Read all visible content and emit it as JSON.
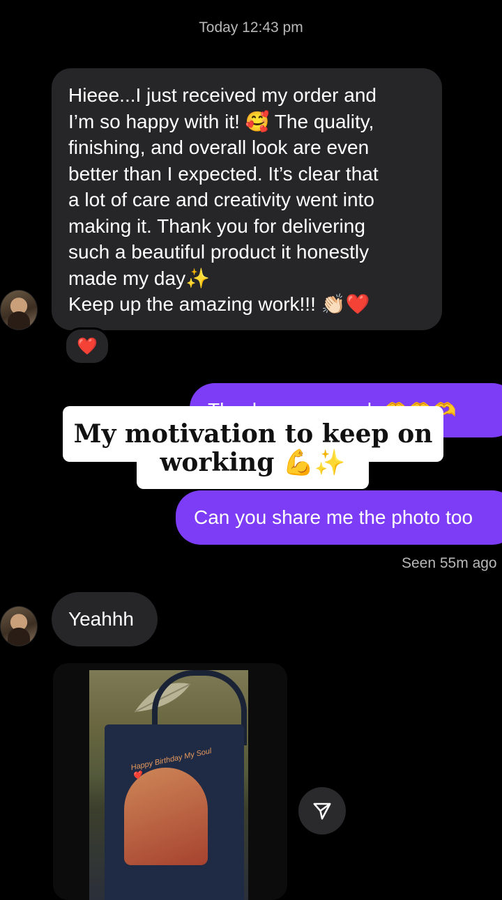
{
  "header": {
    "timestamp": "Today 12:43 pm"
  },
  "messages": {
    "incoming_1": {
      "lines": [
        "Hieee...I just received my order and",
        "I’m so happy with it! 🥰 The quality,",
        "finishing, and overall look are even",
        "better than I expected. It’s clear that",
        "a lot of care and creativity went into",
        "making it. Thank you for delivering",
        "such a beautiful product it honestly",
        "made my day✨",
        "Keep up the amazing work!!! 👏🏻❤️"
      ],
      "reaction": "❤️"
    },
    "outgoing_1": {
      "text": "Thank you so much 🫶🫶🫶"
    },
    "outgoing_2": {
      "text": "Can you share me the photo too"
    },
    "seen": "Seen 55m ago",
    "incoming_2": {
      "text": "Yeahhh"
    },
    "photo": {
      "bag_text": "Happy Birthday My Soul ❤️"
    }
  },
  "overlay": {
    "caption_line1": "My motivation to keep on",
    "caption_line2": "working 💪✨"
  },
  "colors": {
    "background": "#000000",
    "incoming_bubble": "#262628",
    "outgoing_bubble": "#7d3cf5",
    "muted_text": "#b8b8b8"
  },
  "icons": {
    "share": "paper-plane-icon",
    "avatar": "user-avatar"
  }
}
